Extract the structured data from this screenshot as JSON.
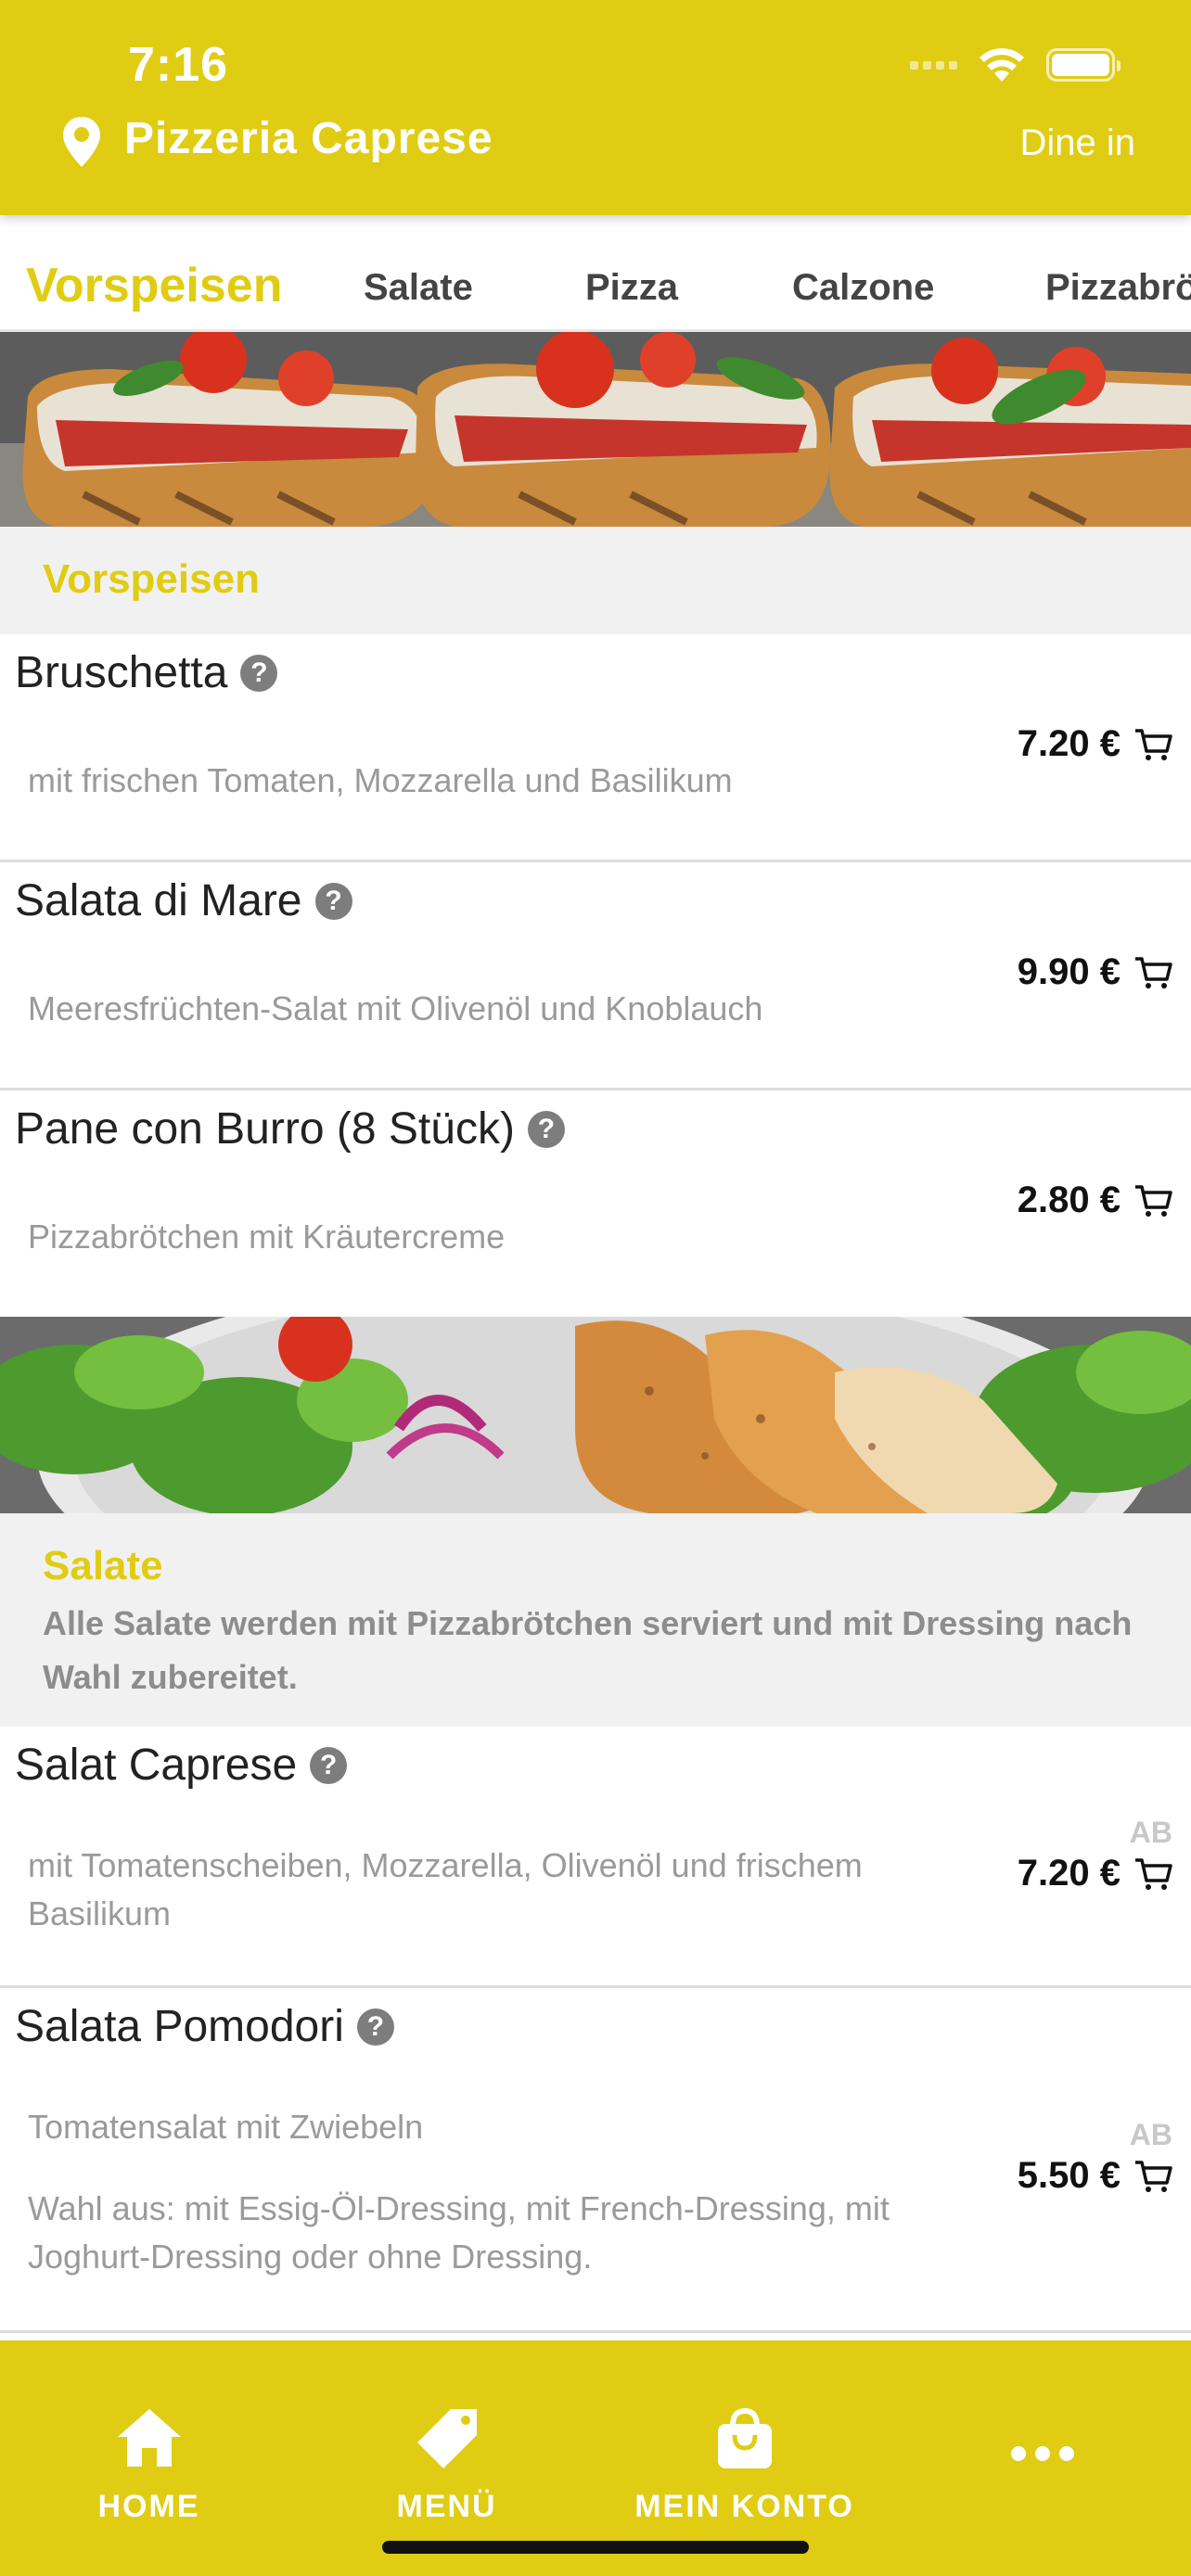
{
  "status": {
    "time": "7:16"
  },
  "header": {
    "restaurant": "Pizzeria Caprese",
    "mode": "Dine in"
  },
  "tabs": [
    {
      "label": "Vorspeisen",
      "active": true
    },
    {
      "label": "Salate"
    },
    {
      "label": "Pizza"
    },
    {
      "label": "Calzone"
    },
    {
      "label": "Pizzabrö"
    }
  ],
  "sections": [
    {
      "title": "Vorspeisen",
      "items": [
        {
          "name": "Bruschetta",
          "desc": "mit frischen Tomaten, Mozzarella und Basilikum",
          "price": "7.20 €"
        },
        {
          "name": "Salata di Mare",
          "desc": "Meeresfrüchten-Salat mit Olivenöl und Knoblauch",
          "price": "9.90 €"
        },
        {
          "name": "Pane con Burro (8 Stück)",
          "desc": "Pizzabrötchen mit Kräutercreme",
          "price": "2.80 €"
        }
      ]
    },
    {
      "title": "Salate",
      "desc": "Alle Salate werden mit Pizzabrötchen serviert und mit Dressing nach Wahl zubereitet.",
      "items": [
        {
          "name": "Salat Caprese",
          "desc": "mit Tomatenscheiben, Mozzarella, Olivenöl und frischem Basilikum",
          "prefix": "AB",
          "price": "7.20 €"
        },
        {
          "name": "Salata Pomodori",
          "desc": "Tomatensalat mit Zwiebeln",
          "desc2": "Wahl aus: mit Essig-Öl-Dressing, mit French-Dressing, mit Joghurt-Dressing oder ohne Dressing.",
          "prefix": "AB",
          "price": "5.50 €"
        }
      ]
    }
  ],
  "nav": {
    "home": "HOME",
    "menu": "MENÜ",
    "account": "MEIN KONTO"
  },
  "colors": {
    "brand": "#e0cc12",
    "muted": "#9a9a9a",
    "sectionBg": "#f1f1f1"
  },
  "icons": [
    "location-pin-icon",
    "help-icon",
    "cart-icon",
    "home-icon",
    "tag-icon",
    "shopping-bag-icon",
    "more-icon"
  ]
}
